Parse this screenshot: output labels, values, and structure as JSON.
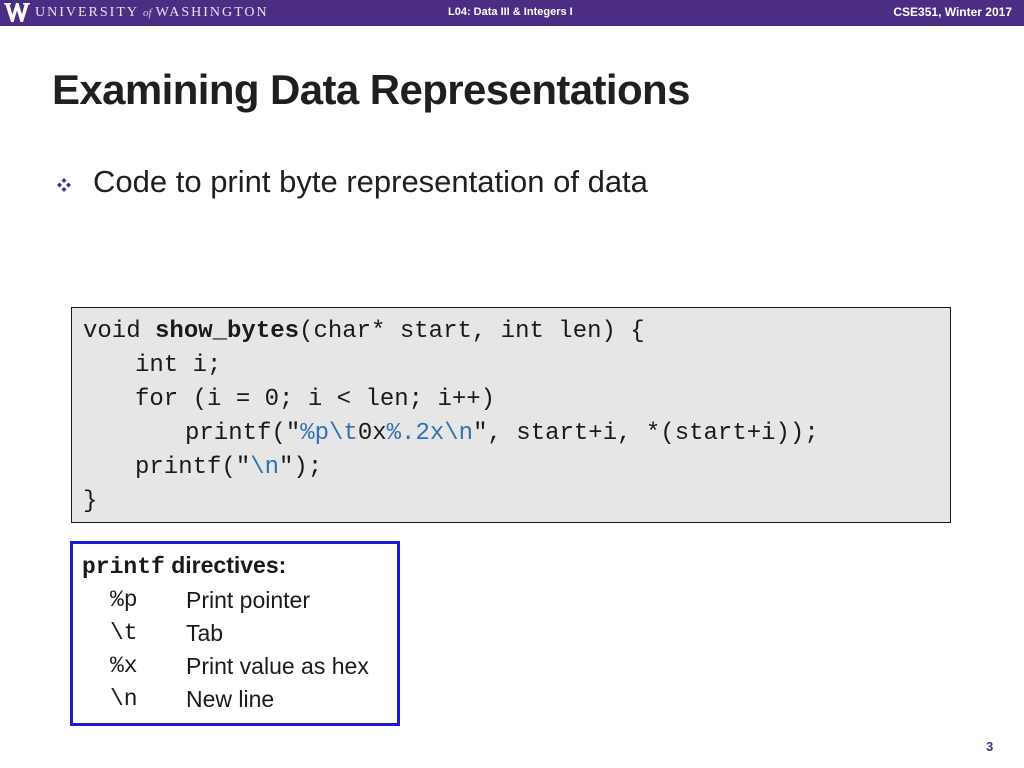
{
  "header": {
    "university_name": "UNIVERSITY",
    "university_of": "of",
    "university_place": "WASHINGTON",
    "lecture": "L04: Data III & Integers I",
    "course": "CSE351, Winter 2017"
  },
  "slide": {
    "title": "Examining Data Representations",
    "bullet": "Code to print byte representation of data",
    "page_number": "3"
  },
  "code": {
    "line1_a": "void ",
    "line1_fn": "show_bytes",
    "line1_b": "(char* start, int len) {",
    "line2": "int i;",
    "line3": "for (i = 0; i < len; i++)",
    "line4_a": "printf(\"",
    "line4_p": "%p",
    "line4_t": "\\t",
    "line4_b": "0x",
    "line4_x": "%.2x",
    "line4_n": "\\n",
    "line4_c": "\", start+i, *(start+i));",
    "line5_a": "printf(\"",
    "line5_n": "\\n",
    "line5_b": "\");",
    "line6": "}"
  },
  "directives": {
    "heading_kw": "printf",
    "heading_text": " directives:",
    "items": [
      {
        "code": "%p",
        "desc": "Print pointer"
      },
      {
        "code": "\\t",
        "desc": "Tab"
      },
      {
        "code": "%x",
        "desc": "Print value as hex"
      },
      {
        "code": "\\n",
        "desc": "New line"
      }
    ]
  },
  "colors": {
    "header_bg": "#4b2e83",
    "code_bg": "#e6e6e6",
    "format_specifier": "#2e74b5",
    "directive_border": "#1a1adb"
  }
}
